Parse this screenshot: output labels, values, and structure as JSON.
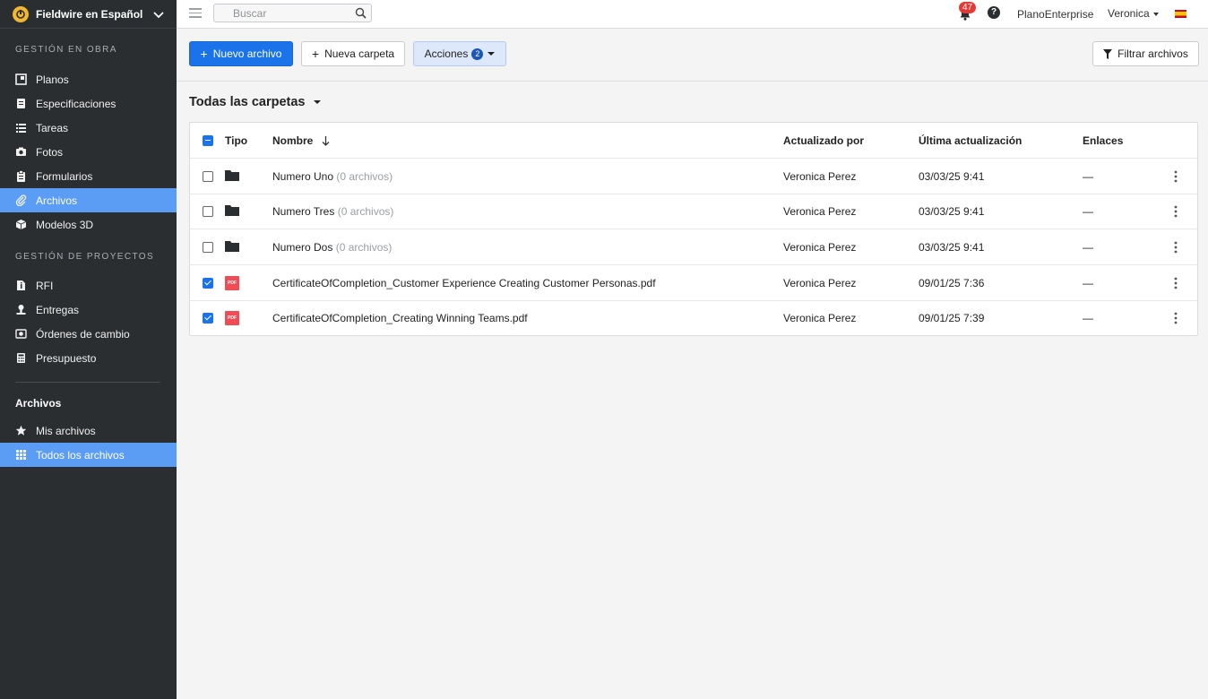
{
  "app": {
    "workspace_name": "Fieldwire en Español",
    "colors": {
      "sidebar_bg": "#2b2e31",
      "active_bg": "#5b9cf5",
      "primary": "#1a73e8",
      "badge": "#e53935",
      "pdf": "#f04c55"
    }
  },
  "sidebar": {
    "section_obra": "GESTIÓN EN OBRA",
    "obra_items": [
      {
        "label": "Planos",
        "icon": "plans-icon"
      },
      {
        "label": "Especificaciones",
        "icon": "specs-icon"
      },
      {
        "label": "Tareas",
        "icon": "tasks-icon"
      },
      {
        "label": "Fotos",
        "icon": "camera-icon"
      },
      {
        "label": "Formularios",
        "icon": "clipboard-icon"
      },
      {
        "label": "Archivos",
        "icon": "paperclip-icon",
        "active": true
      },
      {
        "label": "Modelos 3D",
        "icon": "cube-icon"
      }
    ],
    "section_proyectos": "GESTIÓN DE PROYECTOS",
    "proyectos_items": [
      {
        "label": "RFI",
        "icon": "rfi-icon"
      },
      {
        "label": "Entregas",
        "icon": "submittal-icon"
      },
      {
        "label": "Órdenes de cambio",
        "icon": "change-order-icon"
      },
      {
        "label": "Presupuesto",
        "icon": "calculator-icon"
      }
    ],
    "archivos_heading": "Archivos",
    "archivos_items": [
      {
        "label": "Mis archivos",
        "icon": "star-icon"
      },
      {
        "label": "Todos los archivos",
        "icon": "grid-icon",
        "active": true
      }
    ]
  },
  "topbar": {
    "search_placeholder": "Buscar",
    "notifications_count": "47",
    "help": "?",
    "plan": "PlanoEnterprise",
    "user": "Veronica",
    "language_flag": "spain-flag-icon"
  },
  "actions": {
    "new_file": "Nuevo archivo",
    "new_folder": "Nueva carpeta",
    "actions": "Acciones",
    "actions_count": "2",
    "filter": "Filtrar archivos"
  },
  "folder_selector": "Todas las carpetas",
  "table": {
    "headers": {
      "type": "Tipo",
      "name": "Nombre",
      "updated_by": "Actualizado por",
      "last_update": "Última actualización",
      "links": "Enlaces"
    },
    "select_all_state": "partial",
    "rows": [
      {
        "checked": false,
        "type": "folder",
        "name": "Numero Uno",
        "meta": "(0 archivos)",
        "updated_by": "Veronica Perez",
        "date": "03/03/25 9:41",
        "links": "—"
      },
      {
        "checked": false,
        "type": "folder",
        "name": "Numero Tres",
        "meta": "(0 archivos)",
        "updated_by": "Veronica Perez",
        "date": "03/03/25 9:41",
        "links": "—"
      },
      {
        "checked": false,
        "type": "folder",
        "name": "Numero Dos",
        "meta": "(0 archivos)",
        "updated_by": "Veronica Perez",
        "date": "03/03/25 9:41",
        "links": "—"
      },
      {
        "checked": true,
        "type": "pdf",
        "pdf_label": "PDF",
        "name": "CertificateOfCompletion_Customer Experience Creating Customer Personas.pdf",
        "meta": "",
        "updated_by": "Veronica Perez",
        "date": "09/01/25 7:36",
        "links": "—"
      },
      {
        "checked": true,
        "type": "pdf",
        "pdf_label": "PDF",
        "name": "CertificateOfCompletion_Creating Winning Teams.pdf",
        "meta": "",
        "updated_by": "Veronica Perez",
        "date": "09/01/25 7:39",
        "links": "—"
      }
    ]
  }
}
